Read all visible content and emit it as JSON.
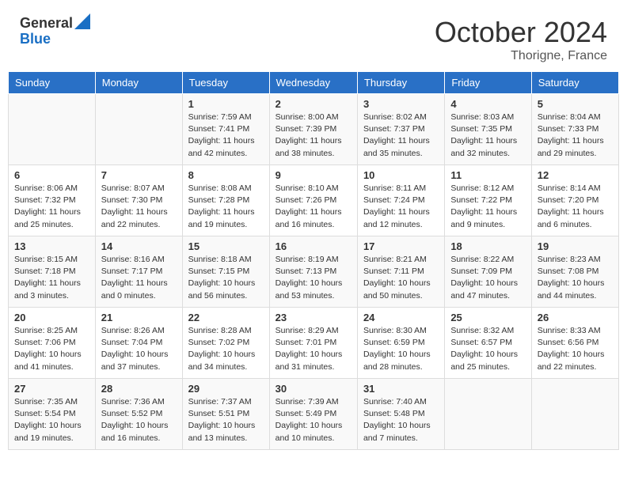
{
  "header": {
    "logo_general": "General",
    "logo_blue": "Blue",
    "month_title": "October 2024",
    "location": "Thorigne, France"
  },
  "days_of_week": [
    "Sunday",
    "Monday",
    "Tuesday",
    "Wednesday",
    "Thursday",
    "Friday",
    "Saturday"
  ],
  "weeks": [
    [
      {
        "day": "",
        "sunrise": "",
        "sunset": "",
        "daylight": ""
      },
      {
        "day": "",
        "sunrise": "",
        "sunset": "",
        "daylight": ""
      },
      {
        "day": "1",
        "sunrise": "Sunrise: 7:59 AM",
        "sunset": "Sunset: 7:41 PM",
        "daylight": "Daylight: 11 hours and 42 minutes."
      },
      {
        "day": "2",
        "sunrise": "Sunrise: 8:00 AM",
        "sunset": "Sunset: 7:39 PM",
        "daylight": "Daylight: 11 hours and 38 minutes."
      },
      {
        "day": "3",
        "sunrise": "Sunrise: 8:02 AM",
        "sunset": "Sunset: 7:37 PM",
        "daylight": "Daylight: 11 hours and 35 minutes."
      },
      {
        "day": "4",
        "sunrise": "Sunrise: 8:03 AM",
        "sunset": "Sunset: 7:35 PM",
        "daylight": "Daylight: 11 hours and 32 minutes."
      },
      {
        "day": "5",
        "sunrise": "Sunrise: 8:04 AM",
        "sunset": "Sunset: 7:33 PM",
        "daylight": "Daylight: 11 hours and 29 minutes."
      }
    ],
    [
      {
        "day": "6",
        "sunrise": "Sunrise: 8:06 AM",
        "sunset": "Sunset: 7:32 PM",
        "daylight": "Daylight: 11 hours and 25 minutes."
      },
      {
        "day": "7",
        "sunrise": "Sunrise: 8:07 AM",
        "sunset": "Sunset: 7:30 PM",
        "daylight": "Daylight: 11 hours and 22 minutes."
      },
      {
        "day": "8",
        "sunrise": "Sunrise: 8:08 AM",
        "sunset": "Sunset: 7:28 PM",
        "daylight": "Daylight: 11 hours and 19 minutes."
      },
      {
        "day": "9",
        "sunrise": "Sunrise: 8:10 AM",
        "sunset": "Sunset: 7:26 PM",
        "daylight": "Daylight: 11 hours and 16 minutes."
      },
      {
        "day": "10",
        "sunrise": "Sunrise: 8:11 AM",
        "sunset": "Sunset: 7:24 PM",
        "daylight": "Daylight: 11 hours and 12 minutes."
      },
      {
        "day": "11",
        "sunrise": "Sunrise: 8:12 AM",
        "sunset": "Sunset: 7:22 PM",
        "daylight": "Daylight: 11 hours and 9 minutes."
      },
      {
        "day": "12",
        "sunrise": "Sunrise: 8:14 AM",
        "sunset": "Sunset: 7:20 PM",
        "daylight": "Daylight: 11 hours and 6 minutes."
      }
    ],
    [
      {
        "day": "13",
        "sunrise": "Sunrise: 8:15 AM",
        "sunset": "Sunset: 7:18 PM",
        "daylight": "Daylight: 11 hours and 3 minutes."
      },
      {
        "day": "14",
        "sunrise": "Sunrise: 8:16 AM",
        "sunset": "Sunset: 7:17 PM",
        "daylight": "Daylight: 11 hours and 0 minutes."
      },
      {
        "day": "15",
        "sunrise": "Sunrise: 8:18 AM",
        "sunset": "Sunset: 7:15 PM",
        "daylight": "Daylight: 10 hours and 56 minutes."
      },
      {
        "day": "16",
        "sunrise": "Sunrise: 8:19 AM",
        "sunset": "Sunset: 7:13 PM",
        "daylight": "Daylight: 10 hours and 53 minutes."
      },
      {
        "day": "17",
        "sunrise": "Sunrise: 8:21 AM",
        "sunset": "Sunset: 7:11 PM",
        "daylight": "Daylight: 10 hours and 50 minutes."
      },
      {
        "day": "18",
        "sunrise": "Sunrise: 8:22 AM",
        "sunset": "Sunset: 7:09 PM",
        "daylight": "Daylight: 10 hours and 47 minutes."
      },
      {
        "day": "19",
        "sunrise": "Sunrise: 8:23 AM",
        "sunset": "Sunset: 7:08 PM",
        "daylight": "Daylight: 10 hours and 44 minutes."
      }
    ],
    [
      {
        "day": "20",
        "sunrise": "Sunrise: 8:25 AM",
        "sunset": "Sunset: 7:06 PM",
        "daylight": "Daylight: 10 hours and 41 minutes."
      },
      {
        "day": "21",
        "sunrise": "Sunrise: 8:26 AM",
        "sunset": "Sunset: 7:04 PM",
        "daylight": "Daylight: 10 hours and 37 minutes."
      },
      {
        "day": "22",
        "sunrise": "Sunrise: 8:28 AM",
        "sunset": "Sunset: 7:02 PM",
        "daylight": "Daylight: 10 hours and 34 minutes."
      },
      {
        "day": "23",
        "sunrise": "Sunrise: 8:29 AM",
        "sunset": "Sunset: 7:01 PM",
        "daylight": "Daylight: 10 hours and 31 minutes."
      },
      {
        "day": "24",
        "sunrise": "Sunrise: 8:30 AM",
        "sunset": "Sunset: 6:59 PM",
        "daylight": "Daylight: 10 hours and 28 minutes."
      },
      {
        "day": "25",
        "sunrise": "Sunrise: 8:32 AM",
        "sunset": "Sunset: 6:57 PM",
        "daylight": "Daylight: 10 hours and 25 minutes."
      },
      {
        "day": "26",
        "sunrise": "Sunrise: 8:33 AM",
        "sunset": "Sunset: 6:56 PM",
        "daylight": "Daylight: 10 hours and 22 minutes."
      }
    ],
    [
      {
        "day": "27",
        "sunrise": "Sunrise: 7:35 AM",
        "sunset": "Sunset: 5:54 PM",
        "daylight": "Daylight: 10 hours and 19 minutes."
      },
      {
        "day": "28",
        "sunrise": "Sunrise: 7:36 AM",
        "sunset": "Sunset: 5:52 PM",
        "daylight": "Daylight: 10 hours and 16 minutes."
      },
      {
        "day": "29",
        "sunrise": "Sunrise: 7:37 AM",
        "sunset": "Sunset: 5:51 PM",
        "daylight": "Daylight: 10 hours and 13 minutes."
      },
      {
        "day": "30",
        "sunrise": "Sunrise: 7:39 AM",
        "sunset": "Sunset: 5:49 PM",
        "daylight": "Daylight: 10 hours and 10 minutes."
      },
      {
        "day": "31",
        "sunrise": "Sunrise: 7:40 AM",
        "sunset": "Sunset: 5:48 PM",
        "daylight": "Daylight: 10 hours and 7 minutes."
      },
      {
        "day": "",
        "sunrise": "",
        "sunset": "",
        "daylight": ""
      },
      {
        "day": "",
        "sunrise": "",
        "sunset": "",
        "daylight": ""
      }
    ]
  ]
}
